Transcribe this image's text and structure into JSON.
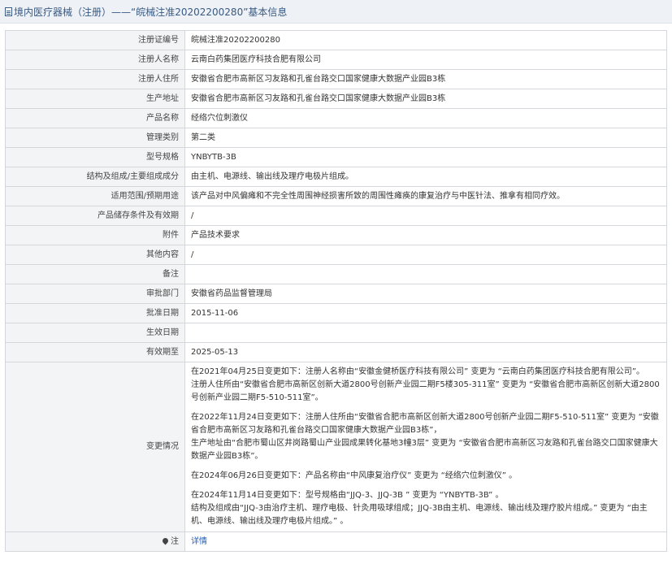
{
  "header": {
    "title": "境内医疗器械（注册）——“皖械注准20202200280”基本信息"
  },
  "rows": [
    {
      "label": "注册证编号",
      "value": "皖械注准20202200280"
    },
    {
      "label": "注册人名称",
      "value": "云南白药集团医疗科技合肥有限公司"
    },
    {
      "label": "注册人住所",
      "value": "安徽省合肥市高新区习友路和孔雀台路交口国家健康大数据产业园B3栋"
    },
    {
      "label": "生产地址",
      "value": "安徽省合肥市高新区习友路和孔雀台路交口国家健康大数据产业园B3栋"
    },
    {
      "label": "产品名称",
      "value": "经络穴位刺激仪"
    },
    {
      "label": "管理类别",
      "value": "第二类"
    },
    {
      "label": "型号规格",
      "value": "YNBYTB-3B"
    },
    {
      "label": "结构及组成/主要组成成分",
      "value": "由主机、电源线、输出线及理疗电极片组成。"
    },
    {
      "label": "适用范围/预期用途",
      "value": "该产品对中风偏瘫和不完全性周围神经损害所致的周围性瘫痪的康复治疗与中医针法、推拿有相同疗效。"
    },
    {
      "label": "产品储存条件及有效期",
      "value": "/"
    },
    {
      "label": "附件",
      "value": "产品技术要求"
    },
    {
      "label": "其他内容",
      "value": "/"
    },
    {
      "label": "备注",
      "value": ""
    },
    {
      "label": "审批部门",
      "value": "安徽省药品监督管理局"
    },
    {
      "label": "批准日期",
      "value": "2015-11-06"
    },
    {
      "label": "生效日期",
      "value": ""
    },
    {
      "label": "有效期至",
      "value": "2025-05-13"
    }
  ],
  "changes": {
    "label": "变更情况",
    "blocks": [
      [
        "在2021年04月25日变更如下：注册人名称由“安徽金健桥医疗科技有限公司” 变更为 “云南白药集团医疗科技合肥有限公司”。",
        "注册人住所由“安徽省合肥市高新区创新大道2800号创新产业园二期F5楼305-311室” 变更为 “安徽省合肥市高新区创新大道2800号创新产业园二期F5-510-511室”。"
      ],
      [
        "在2022年11月24日变更如下：注册人住所由“安徽省合肥市高新区创新大道2800号创新产业园二期F5-510-511室” 变更为 “安徽省合肥市高新区习友路和孔雀台路交口国家健康大数据产业园B3栋”，",
        "生产地址由“合肥市蜀山区井岗路蜀山产业园成果转化基地3幢3层” 变更为 “安徽省合肥市高新区习友路和孔雀台路交口国家健康大数据产业园B3栋”。"
      ],
      [
        "在2024年06月26日变更如下：产品名称由“中风康复治疗仪” 变更为 “经络穴位刺激仪” 。"
      ],
      [
        "在2024年11月14日变更如下：型号规格由“JJQ-3、JJQ-3B ” 变更为 “YNBYTB-3B” 。",
        "结构及组成由“JJQ-3由治疗主机、理疗电极、针灸用吸球组成；JJQ-3B由主机、电源线、输出线及理疗胶片组成。” 变更为 “由主机、电源线、输出线及理疗电极片组成。” 。"
      ]
    ]
  },
  "footer": {
    "icon": "pin-icon",
    "label": "注",
    "link_text": "详情"
  }
}
